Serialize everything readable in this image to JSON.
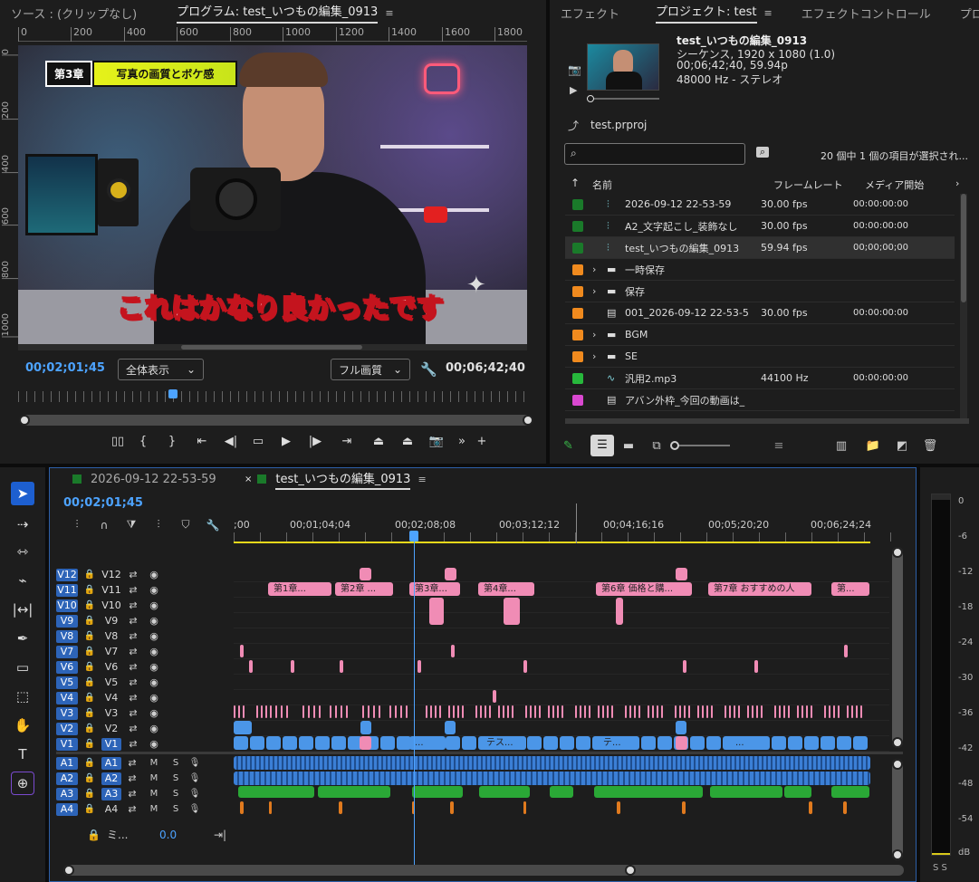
{
  "source_tab": "ソース : (クリップなし)",
  "program_tab": "プログラム: test_いつもの編集_0913",
  "ruler_h": [
    "0",
    "200",
    "400",
    "600",
    "800",
    "1000",
    "1200",
    "1400",
    "1600",
    "1800"
  ],
  "ruler_v": [
    "0",
    "200",
    "400",
    "600",
    "800",
    "1000"
  ],
  "video": {
    "chapter": "第3章",
    "title": "写真の画質とボケ感",
    "caption": "これはかなり良かったです"
  },
  "program": {
    "timecode": "00;02;01;45",
    "zoom": "全体表示",
    "quality": "フル画質",
    "duration": "00;06;42;40"
  },
  "right_tabs": [
    "エフェクト",
    "プロジェクト: test",
    "エフェクトコントロール",
    "プロパ"
  ],
  "seq_info": {
    "name": "test_いつもの編集_0913",
    "line1": "シーケンス, 1920 x 1080 (1.0)",
    "line2": "00;06;42;40, 59.94p",
    "line3": "48000 Hz - ステレオ"
  },
  "project_file": "test.prproj",
  "selection_count": "20 個中 1 個の項目が選択され...",
  "columns": {
    "name": "名前",
    "fps": "フレームレート",
    "start": "メディア開始"
  },
  "items": [
    {
      "color": "#1a7a2a",
      "arrow": "",
      "icon": "seq",
      "name": "2026-09-12 22-53-59",
      "fps": "30.00 fps",
      "start": "00:00:00:00"
    },
    {
      "color": "#1a7a2a",
      "arrow": "",
      "icon": "seq",
      "name": "A2_文字起こし_装飾なし",
      "fps": "30.00 fps",
      "start": "00:00:00:00"
    },
    {
      "color": "#1a7a2a",
      "arrow": "",
      "icon": "seq",
      "name": "test_いつもの編集_0913",
      "fps": "59.94 fps",
      "start": "00;00;00;00"
    },
    {
      "color": "#f08a1e",
      "arrow": "›",
      "icon": "folder",
      "name": "一時保存",
      "fps": "",
      "start": ""
    },
    {
      "color": "#f08a1e",
      "arrow": "›",
      "icon": "folder",
      "name": "保存",
      "fps": "",
      "start": ""
    },
    {
      "color": "#f08a1e",
      "arrow": "",
      "icon": "file",
      "name": "001_2026-09-12 22-53-5",
      "fps": "30.00 fps",
      "start": "00:00:00:00"
    },
    {
      "color": "#f08a1e",
      "arrow": "›",
      "icon": "folder",
      "name": "BGM",
      "fps": "",
      "start": ""
    },
    {
      "color": "#f08a1e",
      "arrow": "›",
      "icon": "folder",
      "name": "SE",
      "fps": "",
      "start": ""
    },
    {
      "color": "#27b83c",
      "arrow": "",
      "icon": "audio",
      "name": "汎用2.mp3",
      "fps": "44100 Hz",
      "start": "00:00:00:00"
    },
    {
      "color": "#d948d0",
      "arrow": "",
      "icon": "file",
      "name": "アバン外枠_今回の動画は_",
      "fps": "",
      "start": ""
    }
  ],
  "timeline_tabs": [
    "2026-09-12 22-53-59",
    "test_いつもの編集_0913"
  ],
  "timeline": {
    "timecode": "00;02;01;45",
    "ruler": [
      ";00",
      "00;01;04;04",
      "00;02;08;08",
      "00;03;12;12",
      "00;04;16;16",
      "00;05;20;20",
      "00;06;24;24"
    ],
    "mix_label": "ミ...",
    "mix_value": "0.0"
  },
  "video_tracks": [
    "V12",
    "V11",
    "V10",
    "V9",
    "V8",
    "V7",
    "V6",
    "V5",
    "V4",
    "V3",
    "V2",
    "V1"
  ],
  "audio_tracks": [
    "A1",
    "A2",
    "A3",
    "A4"
  ],
  "chapters": [
    "第1章...",
    "第2章 ...",
    "第3章...",
    "第4章...",
    "第6章 価格と購...",
    "第7章 おすすめの人",
    "第..."
  ],
  "v1_labels": [
    "...",
    "テス...",
    "テ...",
    "..."
  ],
  "meter": [
    "0",
    "-6",
    "-12",
    "-18",
    "-24",
    "-30",
    "-36",
    "-42",
    "-48",
    "-54",
    "dB"
  ],
  "meter_ss": "S S",
  "colors": {
    "accent": "#4da3ff",
    "pink": "#f08cb5",
    "blue": "#4b96e8",
    "green": "#2aa836"
  }
}
